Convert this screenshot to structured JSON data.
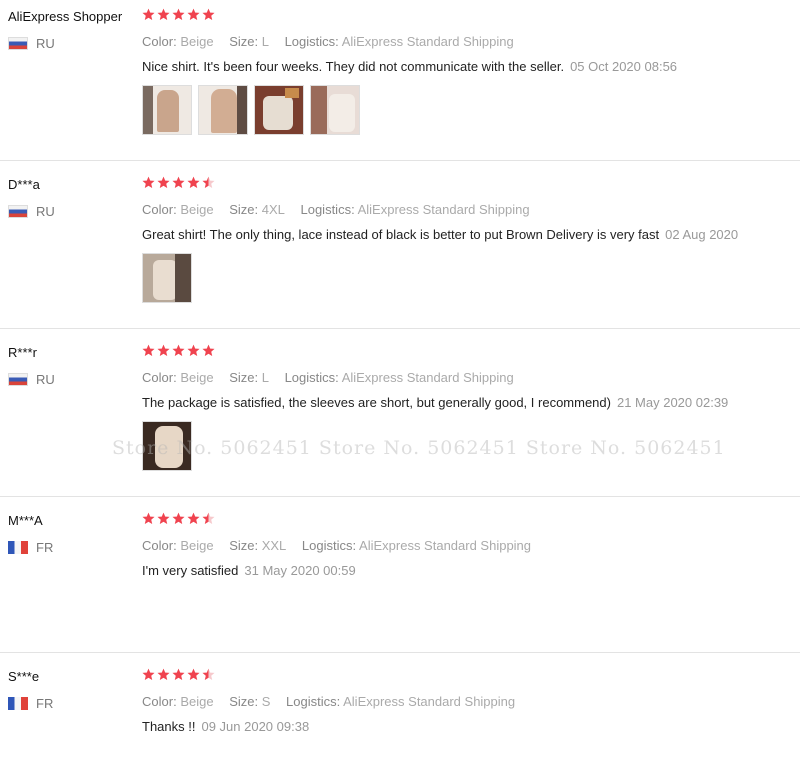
{
  "labels": {
    "color": "Color:",
    "size": "Size:",
    "logistics": "Logistics:"
  },
  "watermark": "Store No. 5062451   Store No. 5062451   Store No. 5062451",
  "colors": {
    "star": "#f0434f",
    "accent_text": "#999999"
  },
  "reviews": [
    {
      "user": "AliExpress Shopper",
      "flag": "ru",
      "country": "RU",
      "rating": 5,
      "color": "Beige",
      "size": "L",
      "logistics": "AliExpress Standard Shipping",
      "text": "Nice shirt. It's been four weeks. They did not communicate with the seller.",
      "date": "05 Oct 2020 08:56",
      "photos": 4
    },
    {
      "user": "D***a",
      "flag": "ru",
      "country": "RU",
      "rating": 4.5,
      "color": "Beige",
      "size": "4XL",
      "logistics": "AliExpress Standard Shipping",
      "text": "Great shirt! The only thing, lace instead of black is better to put Brown Delivery is very fast",
      "date": "02 Aug 2020",
      "photos": 1
    },
    {
      "user": "R***r",
      "flag": "ru",
      "country": "RU",
      "rating": 5,
      "color": "Beige",
      "size": "L",
      "logistics": "AliExpress Standard Shipping",
      "text": "The package is satisfied, the sleeves are short, but generally good, I recommend)",
      "date": "21 May 2020 02:39",
      "photos": 1
    },
    {
      "user": "M***A",
      "flag": "fr",
      "country": "FR",
      "rating": 4.5,
      "color": "Beige",
      "size": "XXL",
      "logistics": "AliExpress Standard Shipping",
      "text": "I'm very satisfied",
      "date": "31 May 2020 00:59",
      "photos": 0
    },
    {
      "user": "S***e",
      "flag": "fr",
      "country": "FR",
      "rating": 4.5,
      "color": "Beige",
      "size": "S",
      "logistics": "AliExpress Standard Shipping",
      "text": "Thanks !!",
      "date": "09 Jun 2020 09:38",
      "photos": 0
    }
  ]
}
